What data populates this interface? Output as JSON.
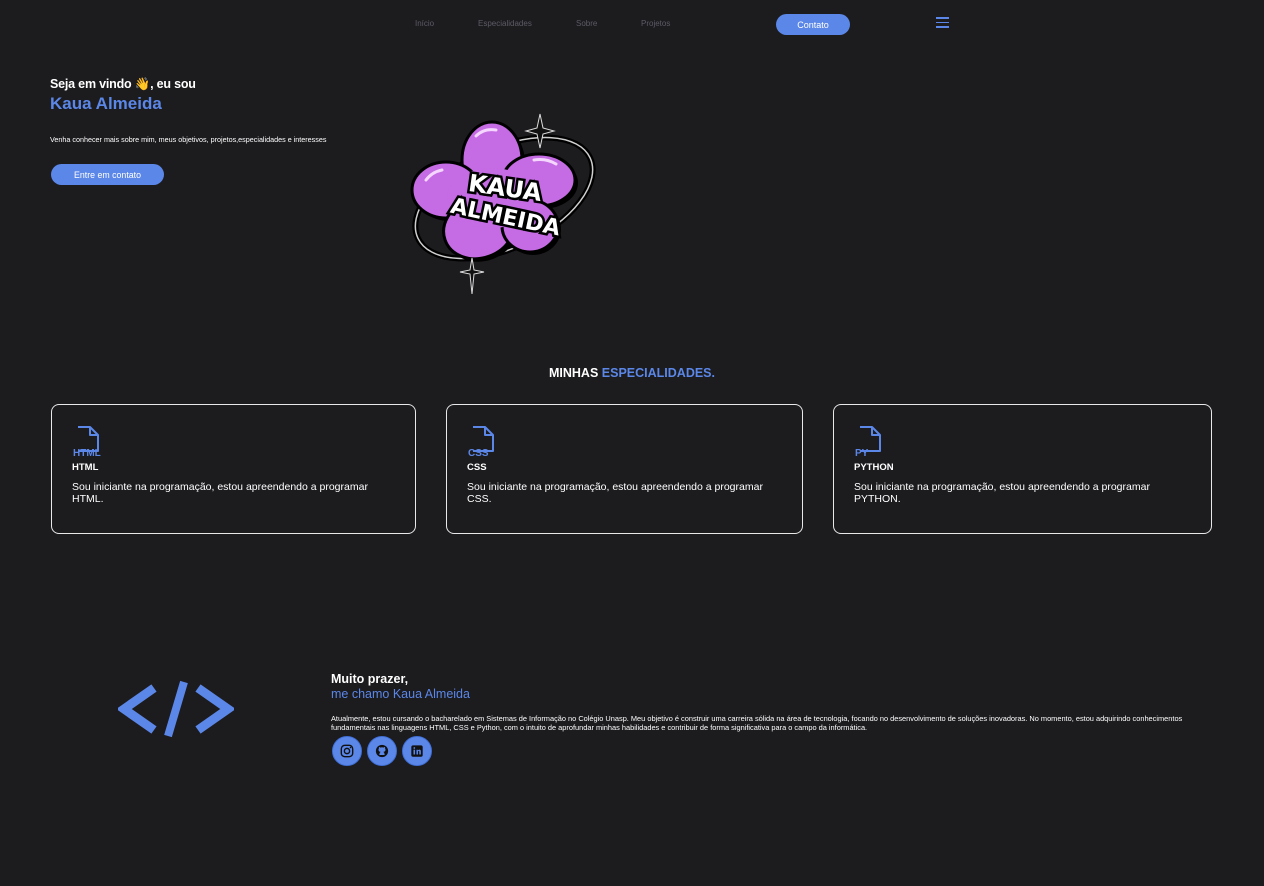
{
  "nav": {
    "links": [
      "Início",
      "Especialidades",
      "Sobre",
      "Projetos"
    ],
    "contact_label": "Contato"
  },
  "hero": {
    "greeting": "Seja em vindo 👋, eu sou",
    "name": "Kaua Almeida",
    "description": "Venha conhecer mais sobre mim, meus objetivos, projetos,especialidades e interesses",
    "cta_label": "Entre em contato",
    "logo_text": [
      "KAUA",
      "ALMEIDA"
    ]
  },
  "specialties": {
    "title_prefix": "MINHAS",
    "title_accent": "ESPECIALIDADES.",
    "cards": [
      {
        "icon_label": "HTML",
        "name": "HTML",
        "text": "Sou iniciante na programação, estou apreendendo a programar HTML."
      },
      {
        "icon_label": "CSS",
        "name": "CSS",
        "text": "Sou iniciante na programação, estou apreendendo a programar CSS."
      },
      {
        "icon_label": "PY",
        "name": "PYTHON",
        "text": "Sou iniciante na programação, estou apreendendo a programar PYTHON."
      }
    ]
  },
  "about": {
    "hello": "Muito prazer,",
    "name_line": "me chamo Kaua Almeida",
    "text": "Atualmente, estou cursando o bacharelado em Sistemas de Informação no Colégio Unasp. Meu objetivo é construir uma carreira sólida na área de tecnologia, focando no desenvolvimento de soluções inovadoras. No momento, estou adquirindo conhecimentos fundamentais nas linguagens HTML, CSS e Python, com o intuito de aprofundar minhas habilidades e contribuir de forma significativa para o campo da informática.",
    "socials": [
      "instagram-icon",
      "github-icon",
      "linkedin-icon"
    ]
  },
  "colors": {
    "background": "#1c1b1e",
    "accent": "#5b87e8",
    "logo_purple": "#c56be3"
  }
}
